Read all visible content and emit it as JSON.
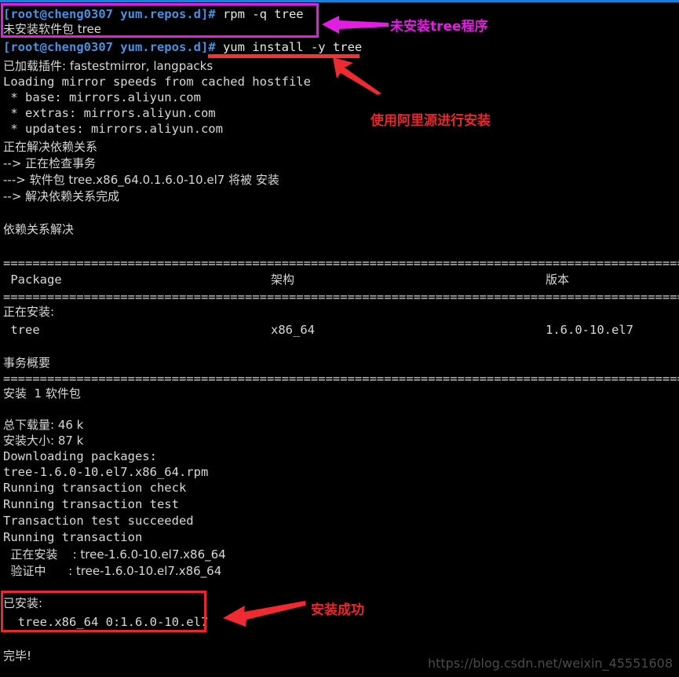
{
  "terminal": {
    "prompt": "[root@cheng0307 yum.repos.d]#",
    "colors": {
      "background": "#000000",
      "foreground": "#d8d8d8",
      "prompt": "#4d8fe0",
      "annotation_magenta": "#e020e0",
      "annotation_red": "#e8282d",
      "top_rule": "#1f7fd4",
      "watermark": "#4a4a4a"
    },
    "lines": {
      "l01_cmd": " rpm -q tree",
      "l02": "未安装软件包 tree",
      "l03_cmd": " yum install -y tree",
      "l04": "已加载插件: fastestmirror, langpacks",
      "l05": "Loading mirror speeds from cached hostfile",
      "l06": " * base: mirrors.aliyun.com",
      "l07": " * extras: mirrors.aliyun.com",
      "l08": " * updates: mirrors.aliyun.com",
      "l09": "正在解决依赖关系",
      "l10": "--> 正在检查事务",
      "l11": "---> 软件包 tree.x86_64.0.1.6.0-10.el7 将被 安装",
      "l12": "--> 解决依赖关系完成",
      "l13": "依赖关系解决",
      "sep1": "================================================================================================",
      "hdr_package": " Package",
      "hdr_arch": "架构",
      "hdr_version": "版本",
      "sep2": "================================================================================================",
      "l14": "正在安装:",
      "row_package": " tree",
      "row_arch": "x86_64",
      "row_version": "1.6.0-10.el7",
      "l15": "事务概要",
      "sep3": "================================================================================================",
      "l16": "安装  1 软件包",
      "l17": "总下载量: 46 k",
      "l18": "安装大小: 87 k",
      "l19": "Downloading packages:",
      "l20": "tree-1.6.0-10.el7.x86_64.rpm",
      "l21": "Running transaction check",
      "l22": "Running transaction test",
      "l23": "Transaction test succeeded",
      "l24": "Running transaction",
      "l25": "  正在安装    : tree-1.6.0-10.el7.x86_64",
      "l26": "  验证中      : tree-1.6.0-10.el7.x86_64",
      "l27": "已安装:",
      "l28": "  tree.x86_64 0:1.6.0-10.el7",
      "l29": "完毕!"
    }
  },
  "annotations": {
    "note_not_installed": "未安装tree程序",
    "note_use_aliyun": "使用阿里源进行安装",
    "note_install_success": "安装成功"
  },
  "watermark": {
    "url": "https://blog.csdn.net/weixin_45551608"
  }
}
